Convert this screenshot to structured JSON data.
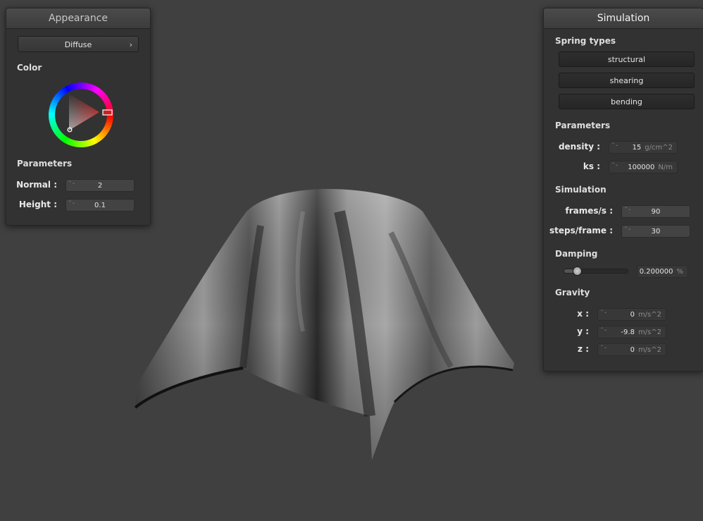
{
  "appearance": {
    "title": "Appearance",
    "shader_label": "Diffuse",
    "chevron": "›",
    "color_label": "Color",
    "parameters_label": "Parameters",
    "normal": {
      "label": "Normal :",
      "value": "2"
    },
    "height": {
      "label": "Height :",
      "value": "0.1"
    },
    "selected_color": "#cc0000"
  },
  "simulation": {
    "title": "Simulation",
    "spring_types": {
      "label": "Spring types",
      "buttons": [
        "structural",
        "shearing",
        "bending"
      ]
    },
    "parameters": {
      "label": "Parameters",
      "density": {
        "label": "density :",
        "value": "15",
        "unit": "g/cm^2"
      },
      "ks": {
        "label": "ks :",
        "value": "100000",
        "unit": "N/m"
      }
    },
    "sim": {
      "label": "Simulation",
      "fps": {
        "label": "frames/s :",
        "value": "90"
      },
      "steps": {
        "label": "steps/frame :",
        "value": "30"
      }
    },
    "damping": {
      "label": "Damping",
      "value": "0.200000",
      "unit": "%",
      "slider_fraction": 0.2
    },
    "gravity": {
      "label": "Gravity",
      "x": {
        "label": "x :",
        "value": "0",
        "unit": "m/s^2"
      },
      "y": {
        "label": "y :",
        "value": "-9.8",
        "unit": "m/s^2"
      },
      "z": {
        "label": "z :",
        "value": "0",
        "unit": "m/s^2"
      }
    }
  },
  "spinner_glyph": "⌃⌄",
  "colors": {
    "background": "#404040",
    "panel": "#323232",
    "cloth": "#8f8f8f"
  }
}
